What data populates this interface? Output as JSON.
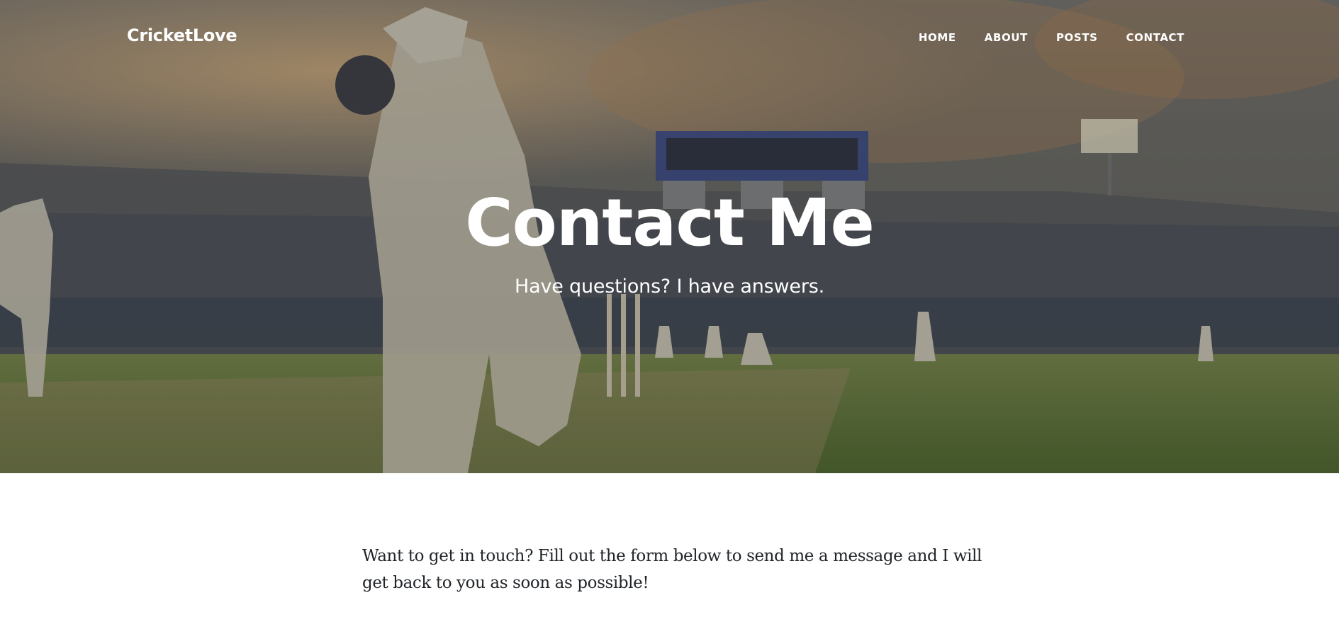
{
  "navbar": {
    "brand": "CricketLove",
    "links": [
      {
        "label": "HOME"
      },
      {
        "label": "ABOUT"
      },
      {
        "label": "POSTS"
      },
      {
        "label": "CONTACT"
      }
    ]
  },
  "hero": {
    "title": "Contact Me",
    "subtitle": "Have questions? I have answers."
  },
  "content": {
    "intro": "Want to get in touch? Fill out the form below to send me a message and I will get back to you as soon as possible!"
  },
  "colors": {
    "text_white": "#ffffff",
    "body_text": "#212529",
    "overlay": "#212529"
  }
}
